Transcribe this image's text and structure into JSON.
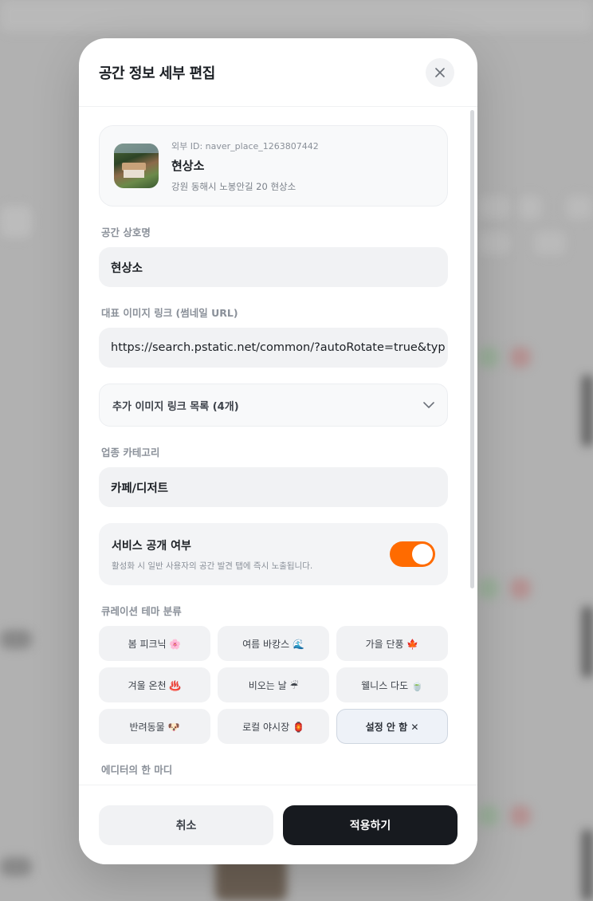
{
  "modal": {
    "title": "공간 정보 세부 편집",
    "close_icon": "close-icon"
  },
  "place": {
    "external_id": "외부 ID: naver_place_1263807442",
    "name": "현상소",
    "address": "강원 동해시 노봉안길 20 현상소"
  },
  "fields": {
    "name_label": "공간 상호명",
    "name_value": "현상소",
    "image_label": "대표 이미지 링크 (썸네일 URL)",
    "image_value": "https://search.pstatic.net/common/?autoRotate=true&typ",
    "extra_images_label": "추가 이미지 링크 목록 (4개)",
    "category_label": "업종 카테고리",
    "category_value": "카페/디저트"
  },
  "visibility": {
    "title": "서비스 공개 여부",
    "description": "활성화 시 일반 사용자의 공간 발견 탭에 즉시 노출됩니다.",
    "enabled": true,
    "accent_color": "#ff6b00"
  },
  "themes": {
    "label": "큐레이션 테마 분류",
    "items": [
      {
        "label": "봄 피크닉 🌸",
        "selected": false
      },
      {
        "label": "여름 바캉스 🌊",
        "selected": false
      },
      {
        "label": "가을 단풍 🍁",
        "selected": false
      },
      {
        "label": "겨울 온천 ♨️",
        "selected": false
      },
      {
        "label": "비오는 날 ☔",
        "selected": false
      },
      {
        "label": "웰니스 다도 🍵",
        "selected": false
      },
      {
        "label": "반려동물 🐶",
        "selected": false
      },
      {
        "label": "로컬 야시장 🏮",
        "selected": false
      },
      {
        "label": "설정 안 함 ✕",
        "selected": true
      }
    ]
  },
  "editor_note": {
    "label": "에디터의 한 마디"
  },
  "footer": {
    "cancel_label": "취소",
    "apply_label": "적용하기"
  }
}
